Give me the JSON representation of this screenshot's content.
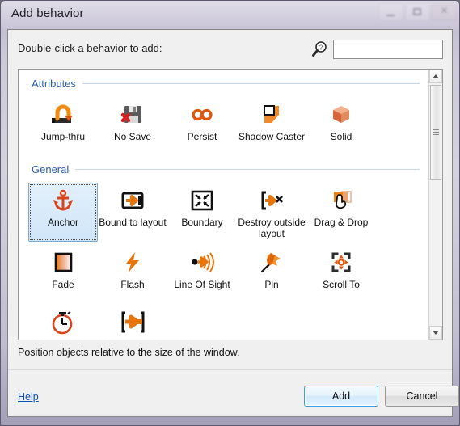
{
  "window": {
    "title": "Add behavior",
    "caption_buttons": [
      {
        "name": "minimize",
        "label": "Minimize"
      },
      {
        "name": "maximize",
        "label": "Maximize"
      },
      {
        "name": "close",
        "label": "Close"
      }
    ]
  },
  "prompt": {
    "label": "Double-click a behavior to add:",
    "search_icon": "search-help-icon",
    "search_value": "",
    "search_placeholder": ""
  },
  "groups": [
    {
      "title": "Attributes",
      "items": [
        {
          "label": "Jump-thru",
          "icon": "jump-thru-icon",
          "selected": false
        },
        {
          "label": "No Save",
          "icon": "no-save-icon",
          "selected": false
        },
        {
          "label": "Persist",
          "icon": "persist-icon",
          "selected": false
        },
        {
          "label": "Shadow Caster",
          "icon": "shadow-caster-icon",
          "selected": false
        },
        {
          "label": "Solid",
          "icon": "solid-icon",
          "selected": false
        }
      ]
    },
    {
      "title": "General",
      "items": [
        {
          "label": "Anchor",
          "icon": "anchor-icon",
          "selected": true
        },
        {
          "label": "Bound to layout",
          "icon": "bound-to-layout-icon",
          "selected": false
        },
        {
          "label": "Boundary",
          "icon": "boundary-icon",
          "selected": false
        },
        {
          "label": "Destroy outside layout",
          "icon": "destroy-outside-layout-icon",
          "selected": false
        },
        {
          "label": "Drag & Drop",
          "icon": "drag-and-drop-icon",
          "selected": false
        },
        {
          "label": "Fade",
          "icon": "fade-icon",
          "selected": false
        },
        {
          "label": "Flash",
          "icon": "flash-icon",
          "selected": false
        },
        {
          "label": "Line Of Sight",
          "icon": "line-of-sight-icon",
          "selected": false
        },
        {
          "label": "Pin",
          "icon": "pin-icon",
          "selected": false
        },
        {
          "label": "Scroll To",
          "icon": "scroll-to-icon",
          "selected": false
        },
        {
          "label": "",
          "icon": "timer-icon",
          "selected": false
        },
        {
          "label": "",
          "icon": "bullet-icon",
          "selected": false
        }
      ]
    }
  ],
  "scrollbar": {
    "up_arrow": "scroll-up-arrow",
    "down_arrow": "scroll-down-arrow",
    "thumb": "scroll-thumb"
  },
  "footer": {
    "status": "Position objects relative to the size of the window.",
    "help_label": "Help",
    "add_label": "Add",
    "cancel_label": "Cancel"
  },
  "colors": {
    "accent_orange": "#e8740c",
    "group_title_blue": "#2a5db0",
    "link_blue": "#0b4fb5",
    "selection_blue": "#cfe6f9",
    "primary_button_border": "#3c9fe0"
  }
}
